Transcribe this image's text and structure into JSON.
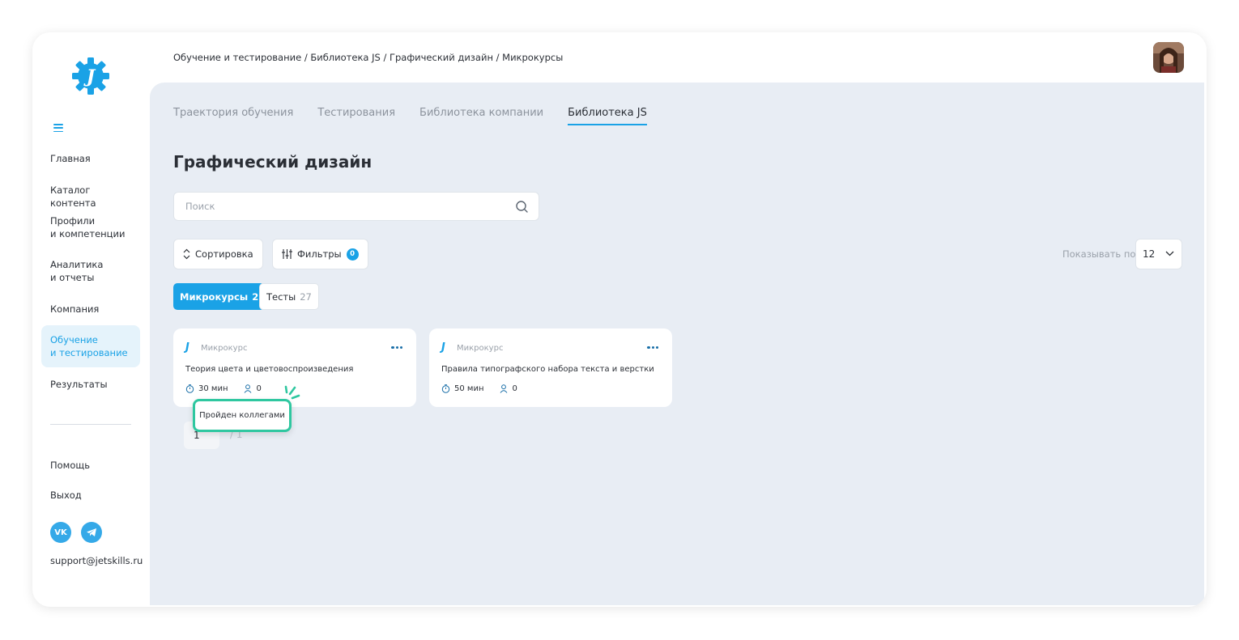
{
  "breadcrumb": "Обучение и тестирование / Библиотека JS / Графический дизайн / Микрокурсы",
  "sidebar": {
    "items": [
      {
        "label": "Главная"
      },
      {
        "label": "Каталог контента"
      },
      {
        "label": "Профили\nи компетенции"
      },
      {
        "label": "Аналитика\nи отчеты"
      },
      {
        "label": "Компания"
      },
      {
        "label": "Обучение\nи тестирование",
        "active": true
      },
      {
        "label": "Результаты"
      },
      {
        "label": "Помощь"
      },
      {
        "label": "Выход"
      }
    ],
    "social": [
      {
        "label": "VK",
        "icon": "vk-icon"
      },
      {
        "label": "",
        "icon": "telegram-icon"
      }
    ],
    "support_email": "support@jetskills.ru"
  },
  "tabs": [
    {
      "label": "Траектория обучения"
    },
    {
      "label": "Тестирования"
    },
    {
      "label": "Библиотека компании"
    },
    {
      "label": "Библиотека JS",
      "active": true
    }
  ],
  "page_title": "Графический дизайн",
  "search": {
    "placeholder": "Поиск"
  },
  "toolbar": {
    "sort_label": "Сортировка",
    "filters_label": "Фильтры",
    "filters_count": "0",
    "show_label": "Показывать по:",
    "per_page": "12"
  },
  "content_filters": [
    {
      "label": "Микрокурсы",
      "count": "2",
      "active": true
    },
    {
      "label": "Тесты",
      "count": "27",
      "active": false
    }
  ],
  "cards": [
    {
      "badge": "J",
      "type": "Микрокурс",
      "title": "Теория цвета и цветовоспроизведения",
      "duration": "30 мин",
      "users": "0"
    },
    {
      "badge": "J",
      "type": "Микрокурс",
      "title": "Правила типографского набора текста и верстки",
      "duration": "50 мин",
      "users": "0"
    }
  ],
  "pagination": {
    "current": "1",
    "total": "/ 1"
  },
  "tooltip": "Пройден коллегами",
  "colors": {
    "accent": "#1aa2e6",
    "highlight": "#2fc7a0",
    "background": "#e8edf4"
  }
}
